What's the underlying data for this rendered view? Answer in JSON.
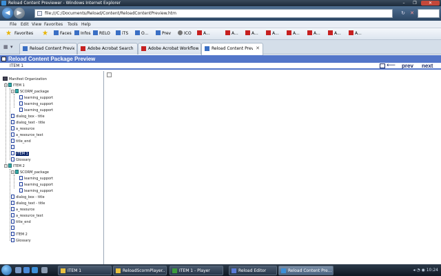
{
  "window": {
    "title": "Reload Content Previewer - Windows Internet Explorer",
    "min_label": "–",
    "max_label": "❐",
    "close_label": "✕"
  },
  "address": {
    "url": "file:///C:/Documents/Reload/Content/ReloadContentPreview.htm",
    "refresh_label": "↻",
    "stop_label": "✕"
  },
  "menu": [
    "File",
    "Edit",
    "View",
    "Favorites",
    "Tools",
    "Help"
  ],
  "favorites": {
    "label": "Favorites",
    "items": [
      {
        "label": "Faces",
        "icon": "blue"
      },
      {
        "label": "Infos",
        "icon": "blue"
      },
      {
        "label": "RELO",
        "icon": "blue"
      },
      {
        "label": "iTS",
        "icon": "blue"
      },
      {
        "label": "O...",
        "icon": "blue"
      },
      {
        "label": "Prev",
        "icon": "blue"
      },
      {
        "label": "ICO",
        "icon": "gray"
      },
      {
        "label": "A...",
        "icon": "acro"
      },
      {
        "label": "A...",
        "icon": "acro"
      },
      {
        "label": "A...",
        "icon": "acro"
      },
      {
        "label": "A...",
        "icon": "acro"
      },
      {
        "label": "A...",
        "icon": "acro"
      },
      {
        "label": "A...",
        "icon": "acro"
      },
      {
        "label": "A...",
        "icon": "acro"
      },
      {
        "label": "A...",
        "icon": "acro"
      }
    ]
  },
  "tabs": [
    {
      "label": "Reload Content Preview",
      "icon": "blue",
      "active": false
    },
    {
      "label": "Adobe Acrobat Search",
      "icon": "acro",
      "active": false
    },
    {
      "label": "Adobe Acrobat Workflows",
      "icon": "acro",
      "active": false
    },
    {
      "label": "Reload Content Previ...",
      "icon": "blue",
      "active": true
    }
  ],
  "tab_close": "✕",
  "preview": {
    "title": "Reload Content Package Preview",
    "breadcrumb": "ITEM 1",
    "prev_label": "prev",
    "next_label": "next",
    "arrow": "⟵"
  },
  "tree": [
    {
      "label": "Manifest Organization",
      "depth": 0,
      "toggle": "",
      "icon": "pkg",
      "selected": false
    },
    {
      "label": "ITEM 1",
      "depth": 1,
      "toggle": "−",
      "icon": "org",
      "selected": false
    },
    {
      "label": "SCORM_package",
      "depth": 2,
      "toggle": "−",
      "icon": "org",
      "selected": false
    },
    {
      "label": "learning_support",
      "depth": 3,
      "toggle": "",
      "icon": "res",
      "selected": false
    },
    {
      "label": "learning_support",
      "depth": 3,
      "toggle": "",
      "icon": "res",
      "selected": false
    },
    {
      "label": "learning_support",
      "depth": 3,
      "toggle": "",
      "icon": "res",
      "selected": false
    },
    {
      "label": "dialog_box - title",
      "depth": 2,
      "toggle": "",
      "icon": "res",
      "selected": false
    },
    {
      "label": "dialog_text - title",
      "depth": 2,
      "toggle": "",
      "icon": "res",
      "selected": false
    },
    {
      "label": "a_resource",
      "depth": 2,
      "toggle": "",
      "icon": "res",
      "selected": false
    },
    {
      "label": "a_resource_text",
      "depth": 2,
      "toggle": "",
      "icon": "res",
      "selected": false
    },
    {
      "label": "title_end",
      "depth": 2,
      "toggle": "",
      "icon": "res",
      "selected": false
    },
    {
      "label": "",
      "depth": 2,
      "toggle": "",
      "icon": "res",
      "selected": false
    },
    {
      "label": "ITEM 1",
      "depth": 2,
      "toggle": "",
      "icon": "res",
      "selected": true
    },
    {
      "label": "Glossary",
      "depth": 2,
      "toggle": "",
      "icon": "res",
      "selected": false
    },
    {
      "label": "ITEM 2",
      "depth": 1,
      "toggle": "−",
      "icon": "org",
      "selected": false
    },
    {
      "label": "SCORM_package",
      "depth": 2,
      "toggle": "−",
      "icon": "org",
      "selected": false
    },
    {
      "label": "learning_support",
      "depth": 3,
      "toggle": "",
      "icon": "res",
      "selected": false
    },
    {
      "label": "learning_support",
      "depth": 3,
      "toggle": "",
      "icon": "res",
      "selected": false
    },
    {
      "label": "learning_support",
      "depth": 3,
      "toggle": "",
      "icon": "res",
      "selected": false
    },
    {
      "label": "dialog_box - title",
      "depth": 2,
      "toggle": "",
      "icon": "res",
      "selected": false
    },
    {
      "label": "dialog_text - title",
      "depth": 2,
      "toggle": "",
      "icon": "res",
      "selected": false
    },
    {
      "label": "a_resource",
      "depth": 2,
      "toggle": "",
      "icon": "res",
      "selected": false
    },
    {
      "label": "a_resource_text",
      "depth": 2,
      "toggle": "",
      "icon": "res",
      "selected": false
    },
    {
      "label": "title_end",
      "depth": 2,
      "toggle": "",
      "icon": "res",
      "selected": false
    },
    {
      "label": "",
      "depth": 2,
      "toggle": "",
      "icon": "res",
      "selected": false
    },
    {
      "label": "ITEM 2",
      "depth": 2,
      "toggle": "",
      "icon": "res",
      "selected": false
    },
    {
      "label": "Glossary",
      "depth": 2,
      "toggle": "",
      "icon": "res",
      "selected": false
    }
  ],
  "taskbar": {
    "buttons": [
      {
        "label": "ITEM 1",
        "active": false,
        "icon_color": "#e8c040"
      },
      {
        "label": "ReloadScormPlayer...",
        "active": false,
        "icon_color": "#e8c040"
      },
      {
        "label": "ITEM 1 - Player",
        "active": false,
        "icon_color": "#3c9a3c"
      },
      {
        "label": "Reload Editor",
        "active": false,
        "icon_color": "#5a7ad8"
      },
      {
        "label": "Reload Content Pre...",
        "active": true,
        "icon_color": "#3c8fd8"
      }
    ],
    "tray": "◂ ◔ ◉ 10:24"
  },
  "colors": {
    "header_bar": "#5376c9",
    "nav_link": "#1a2a66",
    "selected_node": "#0a2468"
  }
}
